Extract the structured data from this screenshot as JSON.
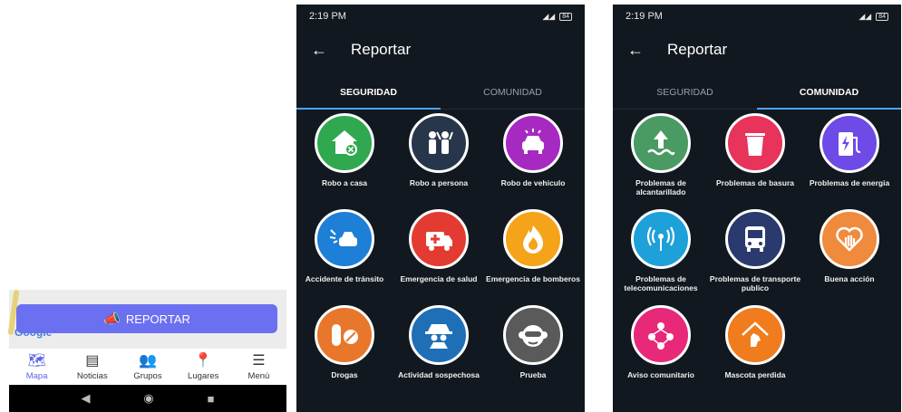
{
  "panel1": {
    "map_attribution": "Google",
    "report_button": "REPORTAR",
    "nav": [
      {
        "label": "Mapa",
        "icon": "map-icon",
        "active": true
      },
      {
        "label": "Noticias",
        "icon": "news-icon",
        "active": false
      },
      {
        "label": "Grupos",
        "icon": "groups-icon",
        "active": false
      },
      {
        "label": "Lugares",
        "icon": "location-pin-icon",
        "active": false
      },
      {
        "label": "Menú",
        "icon": "hamburger-menu-icon",
        "active": false
      }
    ]
  },
  "status_p2": {
    "time": "2:19 PM",
    "battery": "84"
  },
  "status_p3": {
    "time": "2:19 PM",
    "battery": "84"
  },
  "report": {
    "title": "Reportar",
    "tabs": [
      "SEGURIDAD",
      "COMUNIDAD"
    ]
  },
  "seguridad": [
    {
      "label": "Robo a casa",
      "color": "#2fa84f",
      "icon": "house-theft-icon"
    },
    {
      "label": "Robo a persona",
      "color": "#27364a",
      "icon": "person-theft-icon"
    },
    {
      "label": "Robo de vehiculo",
      "color": "#a629c2",
      "icon": "car-alarm-icon"
    },
    {
      "label": "Accidente de tránsito",
      "color": "#1e7fd6",
      "icon": "car-crash-icon"
    },
    {
      "label": "Emergencia de salud",
      "color": "#e33b32",
      "icon": "ambulance-icon"
    },
    {
      "label": "Emergencia de bomberos",
      "color": "#f5a318",
      "icon": "fire-icon"
    },
    {
      "label": "Drogas",
      "color": "#e8772b",
      "icon": "pills-icon"
    },
    {
      "label": "Actividad sospechosa",
      "color": "#1f6fb7",
      "icon": "spy-icon"
    },
    {
      "label": "Prueba",
      "color": "#5a5a5a",
      "icon": "monkey-icon"
    }
  ],
  "comunidad": [
    {
      "label": "Problemas de alcantarillado",
      "color": "#4a9a63",
      "icon": "sewer-icon"
    },
    {
      "label": "Problemas de basura",
      "color": "#e8335b",
      "icon": "trash-icon"
    },
    {
      "label": "Problemas de energia",
      "color": "#6e4ae6",
      "icon": "ev-charger-icon"
    },
    {
      "label": "Problemas de telecomunicaciones",
      "color": "#1ea0d8",
      "icon": "antenna-icon"
    },
    {
      "label": "Problemas de transporte publico",
      "color": "#2a3a6e",
      "icon": "bus-icon"
    },
    {
      "label": "Buena acción",
      "color": "#f08a3c",
      "icon": "heart-hand-icon"
    },
    {
      "label": "Aviso comunitario",
      "color": "#e8297a",
      "icon": "community-icon"
    },
    {
      "label": "Mascota perdida",
      "color": "#f07c1e",
      "icon": "lost-pet-icon"
    }
  ]
}
